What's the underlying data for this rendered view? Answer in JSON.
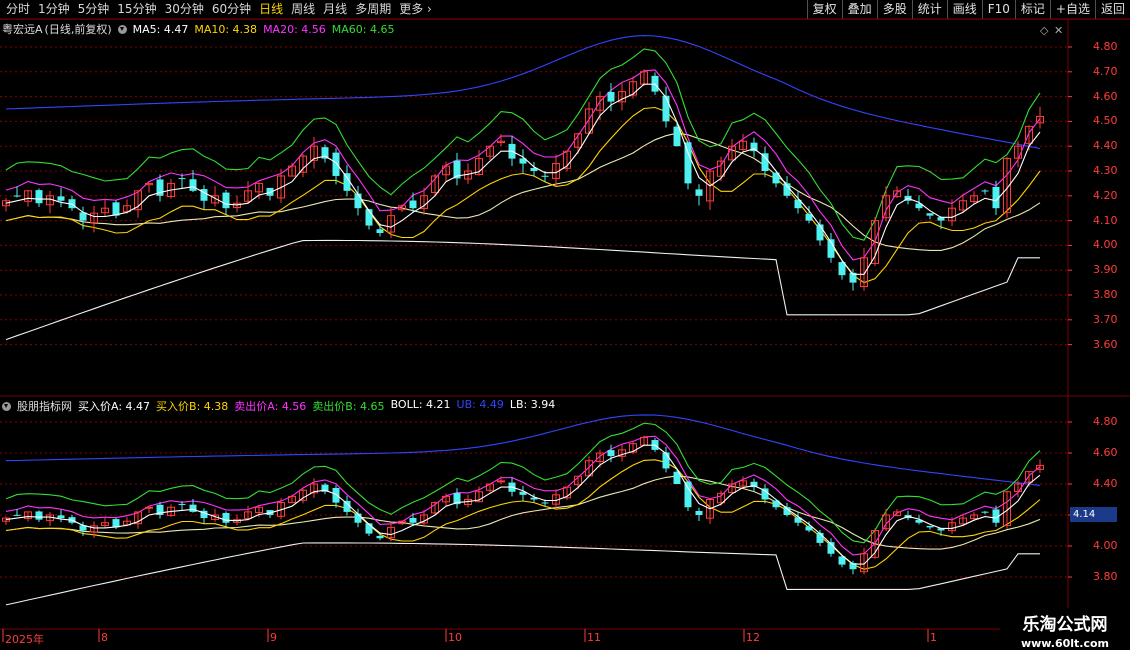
{
  "toolbar": {
    "periods": [
      "分时",
      "1分钟",
      "5分钟",
      "15分钟",
      "30分钟",
      "60分钟",
      "日线",
      "周线",
      "月线",
      "多周期",
      "更多"
    ],
    "active_period": "日线",
    "right_buttons": [
      "复权",
      "叠加",
      "多股",
      "统计",
      "画线",
      "F10",
      "标记",
      "+自选",
      "返回"
    ]
  },
  "main_legend": {
    "stock": "粤宏远A",
    "mode": "(日线,前复权)",
    "items": [
      {
        "label": "MA5: 4.47",
        "color": "#ffffff"
      },
      {
        "label": "MA10: 4.38",
        "color": "#ffd400"
      },
      {
        "label": "MA20: 4.56",
        "color": "#ff33ff"
      },
      {
        "label": "MA60: 4.65",
        "color": "#33dd33"
      }
    ]
  },
  "sub_legend": {
    "indicator": "股朋指标网",
    "items": [
      {
        "label": "买入价A: 4.47",
        "color": "#ffffff"
      },
      {
        "label": "买入价B: 4.38",
        "color": "#ffd400"
      },
      {
        "label": "卖出价A: 4.56",
        "color": "#ff33ff"
      },
      {
        "label": "卖出价B: 4.65",
        "color": "#33dd33"
      },
      {
        "label": "BOLL: 4.21",
        "color": "#ffffff"
      },
      {
        "label": "UB: 4.49",
        "color": "#3344ff"
      },
      {
        "label": "LB: 3.94",
        "color": "#ffffff"
      }
    ]
  },
  "price_axis_main": [
    "4.80",
    "4.70",
    "4.60",
    "4.50",
    "4.40",
    "4.30",
    "4.20",
    "4.10",
    "4.00",
    "3.90",
    "3.80",
    "3.70",
    "3.60"
  ],
  "price_axis_sub": [
    "4.80",
    "4.60",
    "4.40",
    "4.20",
    "4.00",
    "3.80"
  ],
  "current_price": "4.14",
  "date_axis": [
    {
      "label": "2025年",
      "month": 0
    },
    {
      "label": "8",
      "month": 1
    },
    {
      "label": "9",
      "month": 2
    },
    {
      "label": "10",
      "month": 3
    },
    {
      "label": "11",
      "month": 4
    },
    {
      "label": "12",
      "month": 5
    },
    {
      "label": "1",
      "month": 6
    }
  ],
  "watermark": {
    "title": "乐淘公式网",
    "url": "www.60lt.com"
  },
  "colors": {
    "up": "#ff3b3b",
    "down": "#4ff0f0",
    "ma5": "#ffffff",
    "ma10": "#ffd400",
    "ma20": "#ff33ff",
    "ma60": "#33dd33",
    "ub": "#3344ff",
    "grid": "#8a0000"
  },
  "chart_data": {
    "type": "candlestick",
    "x": [
      "2025-07",
      "2025-08",
      "2025-09",
      "2025-10",
      "2025-11",
      "2025-12",
      "2026-01"
    ],
    "close_path": [
      4.18,
      4.2,
      4.22,
      4.17,
      4.2,
      4.18,
      4.15,
      4.1,
      4.13,
      4.15,
      4.12,
      4.16,
      4.22,
      4.25,
      4.2,
      4.25,
      4.27,
      4.22,
      4.18,
      4.2,
      4.15,
      4.17,
      4.22,
      4.25,
      4.2,
      4.28,
      4.32,
      4.36,
      4.4,
      4.35,
      4.28,
      4.22,
      4.15,
      4.08,
      4.05,
      4.12,
      4.16,
      4.15,
      4.2,
      4.28,
      4.32,
      4.27,
      4.3,
      4.35,
      4.4,
      4.42,
      4.35,
      4.33,
      4.3,
      4.28,
      4.33,
      4.38,
      4.45,
      4.55,
      4.6,
      4.58,
      4.62,
      4.66,
      4.7,
      4.62,
      4.5,
      4.4,
      4.25,
      4.2,
      4.3,
      4.34,
      4.4,
      4.42,
      4.38,
      4.3,
      4.25,
      4.2,
      4.15,
      4.1,
      4.02,
      3.95,
      3.88,
      3.85,
      3.95,
      4.1,
      4.2,
      4.22,
      4.18,
      4.15,
      4.12,
      4.1,
      4.15,
      4.18,
      4.2,
      4.22,
      4.15,
      4.35,
      4.4,
      4.48,
      4.52
    ]
  }
}
